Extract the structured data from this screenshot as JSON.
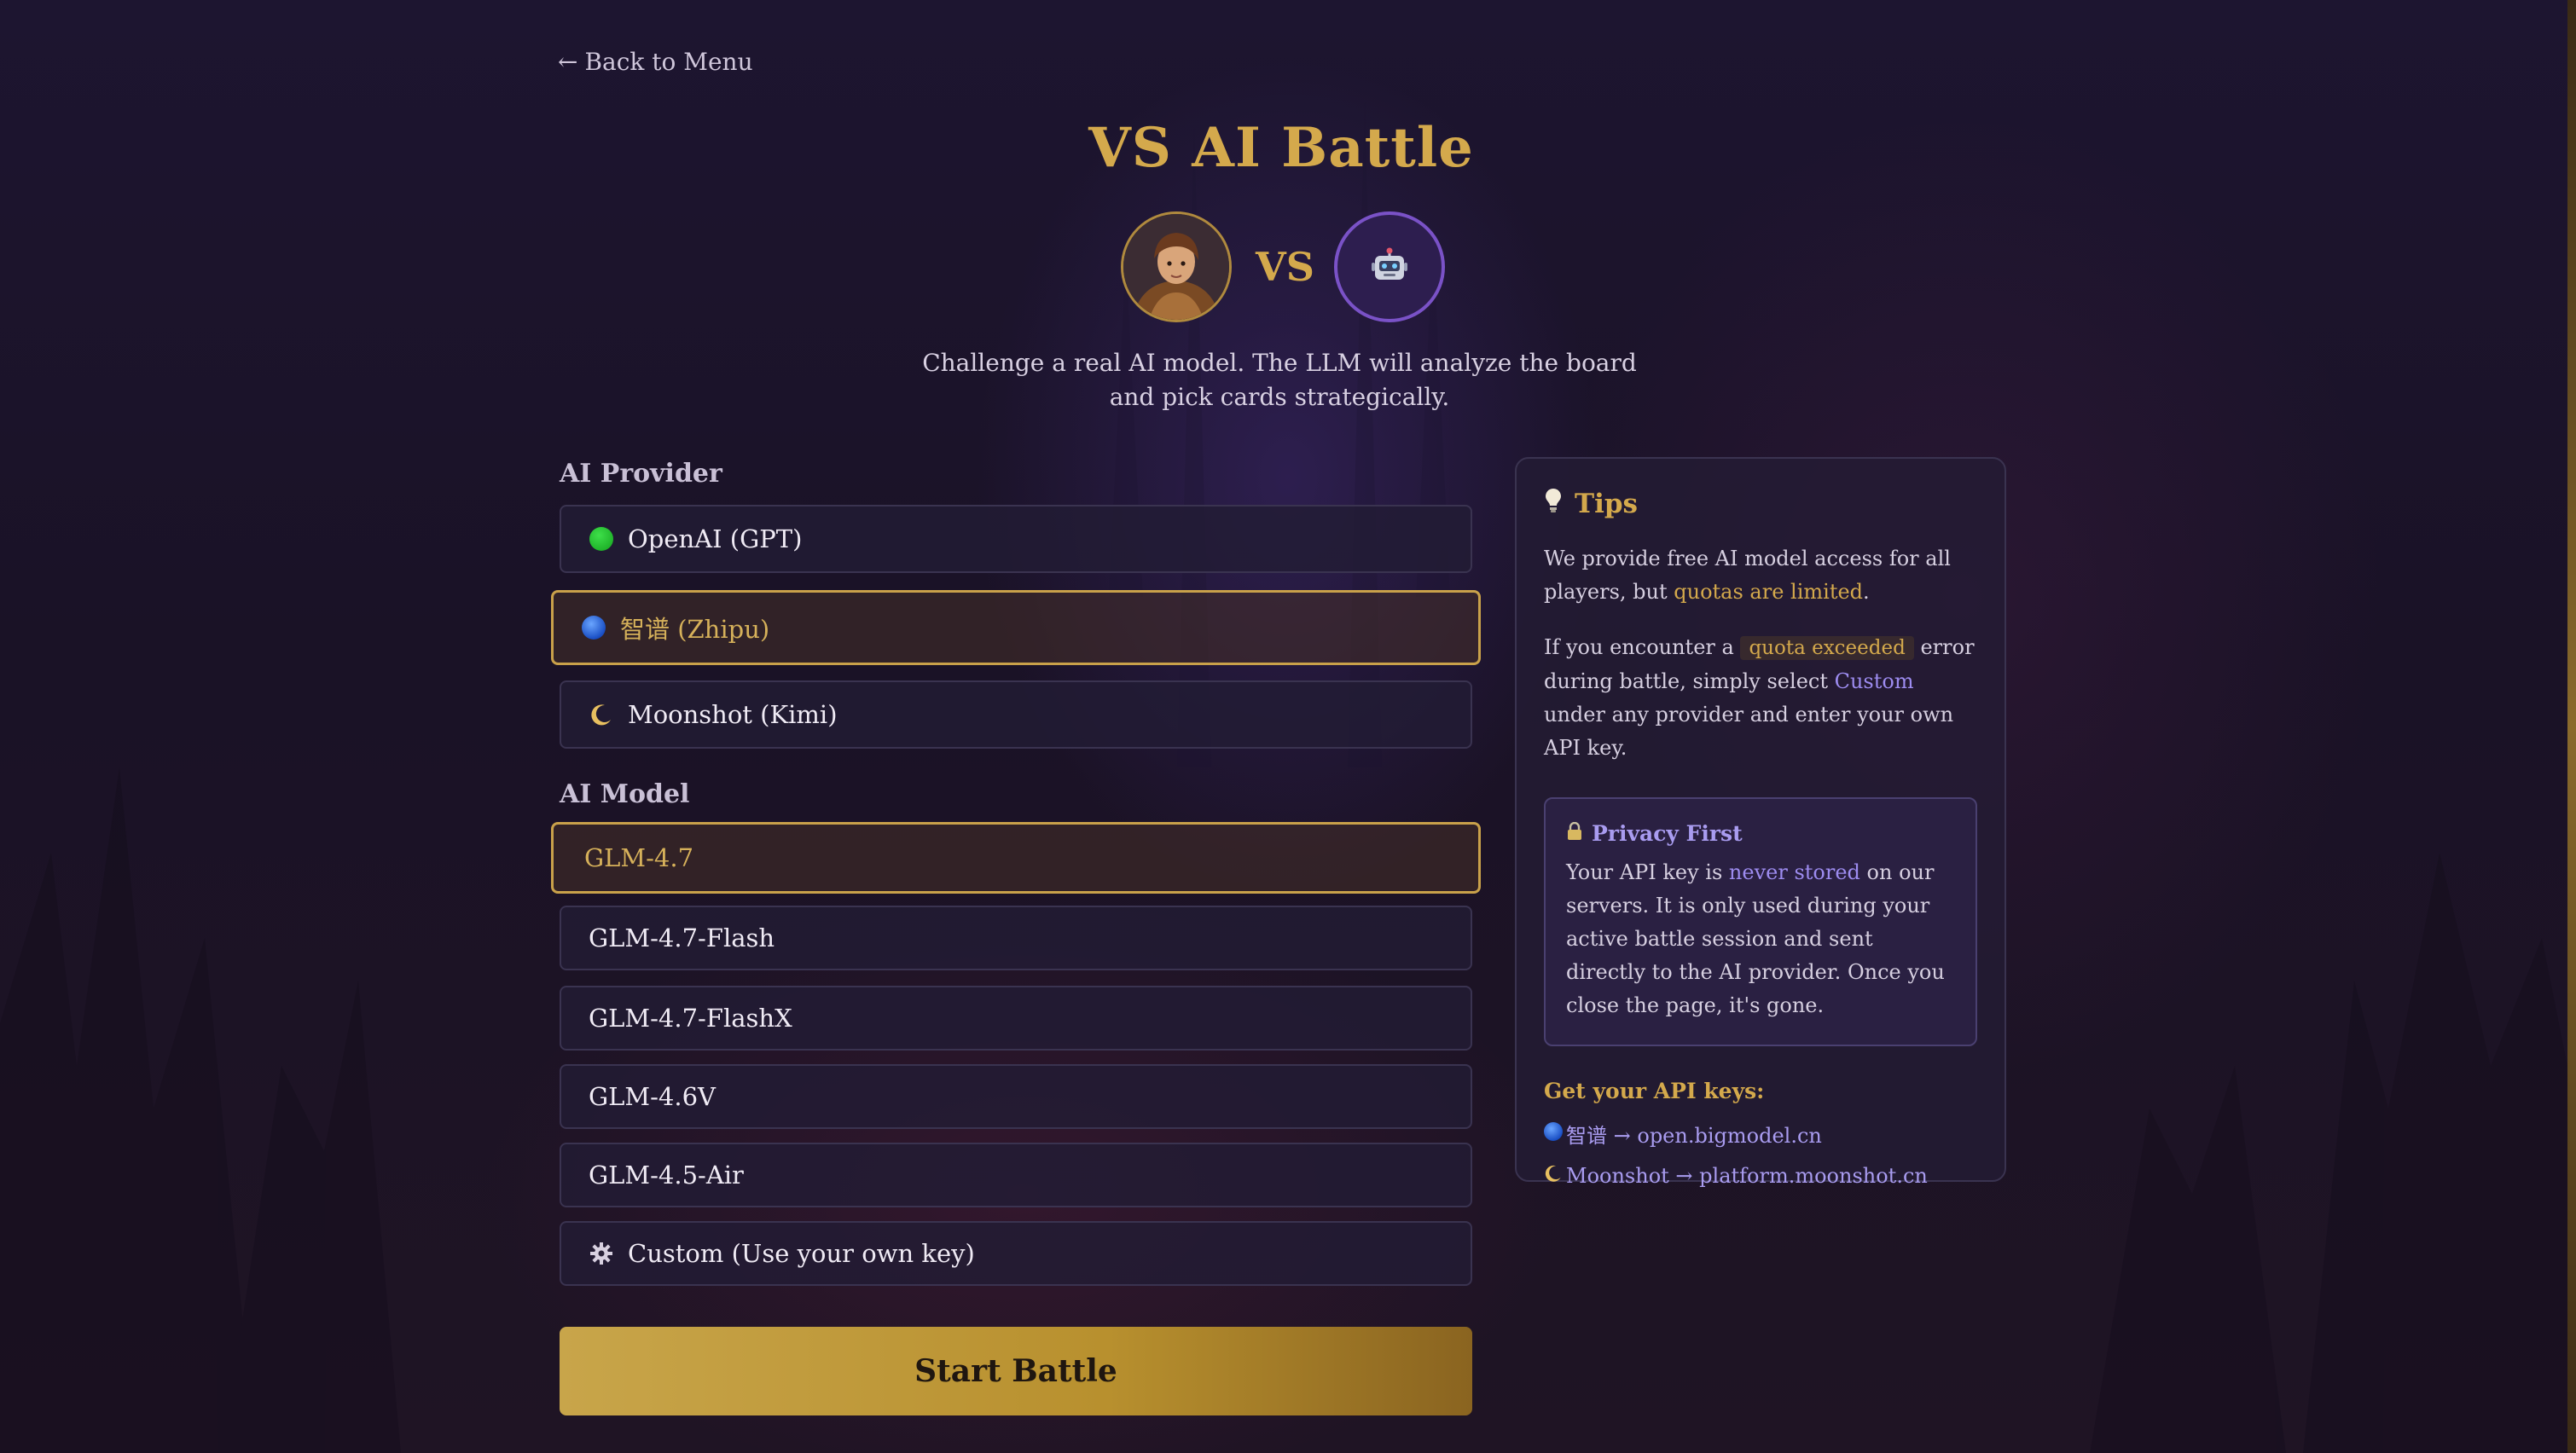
{
  "nav": {
    "back_arrow": "←",
    "back_label": "Back to Menu"
  },
  "header": {
    "title": "VS AI Battle",
    "vs_label": "VS",
    "subtitle": "Challenge a real AI model. The LLM will analyze the board and pick cards strategically."
  },
  "provider": {
    "label": "AI Provider",
    "options": [
      {
        "icon": "green-circle-icon",
        "label": "OpenAI (GPT)",
        "selected": false
      },
      {
        "icon": "blue-circle-icon",
        "label": "智谱 (Zhipu)",
        "selected": true
      },
      {
        "icon": "crescent-moon-icon",
        "label": "Moonshot (Kimi)",
        "selected": false
      }
    ]
  },
  "model": {
    "label": "AI Model",
    "options": [
      {
        "label": "GLM-4.7",
        "selected": true
      },
      {
        "label": "GLM-4.7-Flash",
        "selected": false
      },
      {
        "label": "GLM-4.7-FlashX",
        "selected": false
      },
      {
        "label": "GLM-4.6V",
        "selected": false
      },
      {
        "label": "GLM-4.5-Air",
        "selected": false
      },
      {
        "label": "Custom (Use your own key)",
        "selected": false,
        "icon": "gear-icon"
      }
    ]
  },
  "start_button": {
    "label": "Start Battle"
  },
  "tips": {
    "title": "Tips",
    "p1_a": "We provide free AI model access for all players, but ",
    "p1_highlight": "quotas are limited",
    "p1_end": ".",
    "p2_a": "If you encounter a ",
    "p2_code": "quota exceeded",
    "p2_b": " error during battle, simply select ",
    "p2_custom": "Custom",
    "p2_c": " under any provider and enter your own API key.",
    "privacy": {
      "title": "Privacy First",
      "a": "Your API key is ",
      "highlight": "never stored",
      "b": " on our servers. It is only used during your active battle session and sent directly to the AI provider. Once you close the page, it's gone."
    },
    "keys_title": "Get your API keys:",
    "keys": [
      {
        "icon": "blue-circle-icon",
        "text": "智谱 → open.bigmodel.cn"
      },
      {
        "icon": "crescent-moon-icon",
        "text": "Moonshot → platform.moonshot.cn"
      }
    ]
  },
  "colors": {
    "accent_gold": "#d4a94c",
    "accent_purple": "#9d8cf0",
    "background": "#171024"
  }
}
